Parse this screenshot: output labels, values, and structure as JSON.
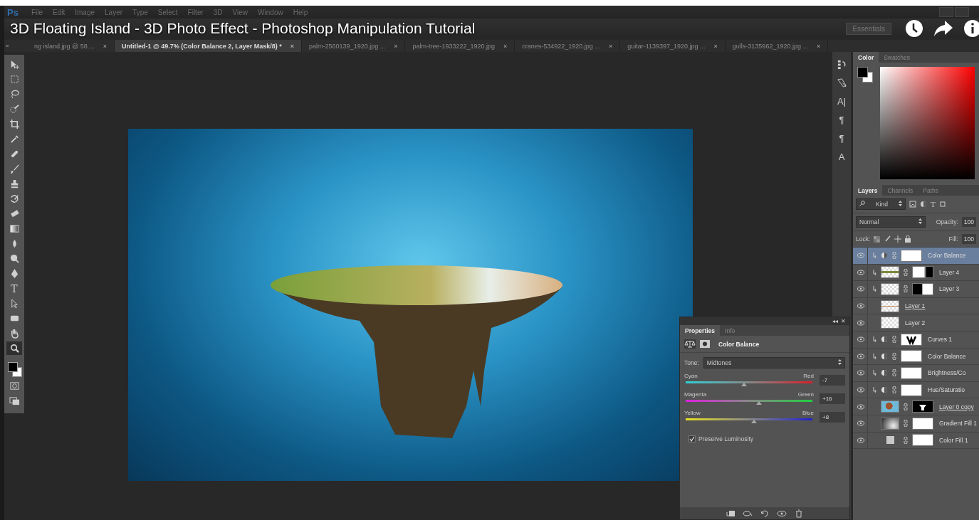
{
  "video_title": "3D Floating Island - 3D Photo Effect - Photoshop Manipulation Tutorial",
  "menu_bar": {
    "app_label": "Ps",
    "items": [
      "File",
      "Edit",
      "Image",
      "Layer",
      "Type",
      "Select",
      "Filter",
      "3D",
      "View",
      "Window",
      "Help"
    ]
  },
  "workspace": "Essentials",
  "tabs_collapse": "»",
  "document_tabs": [
    {
      "label": "ng island.jpg @ 58....",
      "close": "×",
      "selected": false
    },
    {
      "label": "Untitled-1 @ 49.7% (Color Balance 2, Layer Mask/8) *",
      "close": "×",
      "selected": true
    },
    {
      "label": "palm-2560139_1920.jpg ...",
      "close": "×",
      "selected": false
    },
    {
      "label": "palm-tree-1933222_1920.jpg",
      "close": "×",
      "selected": false
    },
    {
      "label": "cranes-534922_1920.jpg ...",
      "close": "×",
      "selected": false
    },
    {
      "label": "guitar-1139397_1920.jpg ...",
      "close": "×",
      "selected": false
    },
    {
      "label": "gulls-3135962_1920.jpg ...",
      "close": "×",
      "selected": false
    }
  ],
  "toolbar": {
    "tools": [
      {
        "kind": "move",
        "selected": false
      },
      {
        "kind": "marquee",
        "selected": false
      },
      {
        "kind": "lasso",
        "selected": false
      },
      {
        "kind": "quick-select",
        "selected": false
      },
      {
        "kind": "crop",
        "selected": false
      },
      {
        "kind": "eyedropper",
        "selected": false
      },
      {
        "kind": "healing",
        "selected": false
      },
      {
        "kind": "brush",
        "selected": false
      },
      {
        "kind": "stamp",
        "selected": false
      },
      {
        "kind": "history-brush",
        "selected": false
      },
      {
        "kind": "eraser",
        "selected": false
      },
      {
        "kind": "gradient",
        "selected": false
      },
      {
        "kind": "blur",
        "selected": false
      },
      {
        "kind": "dodge",
        "selected": false
      },
      {
        "kind": "pen",
        "selected": false
      },
      {
        "kind": "type",
        "glyph": "T",
        "selected": false
      },
      {
        "kind": "path-select",
        "selected": false
      },
      {
        "kind": "shape",
        "selected": false
      },
      {
        "kind": "hand",
        "selected": false
      },
      {
        "kind": "zoom",
        "selected": true
      }
    ]
  },
  "dock_icons": [
    {
      "kind": "history"
    },
    {
      "kind": "brushes"
    },
    {
      "kind": "character",
      "glyph": "A|"
    },
    {
      "kind": "paragraph",
      "glyph": "¶"
    },
    {
      "kind": "char-styles",
      "glyph": "¶"
    },
    {
      "kind": "para-styles",
      "glyph": "A"
    }
  ],
  "color_panel": {
    "tabs": [
      {
        "label": "Color",
        "selected": true
      },
      {
        "label": "Swatches",
        "selected": false
      }
    ]
  },
  "layers_panel": {
    "tabs": [
      {
        "label": "Layers",
        "selected": true
      },
      {
        "label": "Channels",
        "selected": false
      },
      {
        "label": "Paths",
        "selected": false
      }
    ],
    "filter": "Kind",
    "type_filter": "T",
    "blend_mode": "Normal",
    "opacity_label": "Opacity:",
    "opacity": "100",
    "lock_label": "Lock:",
    "fill_label": "Fill:",
    "fill": "100",
    "layers": [
      {
        "name": "Color Balance",
        "selected": true,
        "clipped": true,
        "adjustment": true,
        "mask": {
          "kind": "white"
        },
        "linked": false
      },
      {
        "name": "Layer 4",
        "selected": false,
        "clipped": true,
        "thumb": {
          "kind": "checker-green"
        },
        "mask": {
          "kind": "white-black"
        },
        "linked": false
      },
      {
        "name": "Layer 3",
        "selected": false,
        "clipped": true,
        "thumb": {
          "kind": "checker"
        },
        "mask": {
          "kind": "black-white"
        },
        "linked": false
      },
      {
        "name": "Layer 1",
        "selected": false,
        "clipped": false,
        "thumb": {
          "kind": "checker-orange"
        },
        "linked": true
      },
      {
        "name": "Layer 2",
        "selected": false,
        "clipped": false,
        "thumb": {
          "kind": "checker"
        },
        "linked": false
      },
      {
        "name": "Curves 1",
        "selected": false,
        "clipped": true,
        "adjustment": true,
        "mask": {
          "kind": "curves"
        },
        "linked": false
      },
      {
        "name": "Color Balance",
        "selected": false,
        "clipped": true,
        "adjustment": true,
        "mask": {
          "kind": "white"
        },
        "linked": false
      },
      {
        "name": "Brightness/Co",
        "selected": false,
        "clipped": true,
        "adjustment": true,
        "mask": {
          "kind": "white"
        },
        "linked": false
      },
      {
        "name": "Hue/Saturatio",
        "selected": false,
        "clipped": true,
        "adjustment": true,
        "mask": {
          "kind": "white"
        },
        "linked": false
      },
      {
        "name": "Layer 0 copy",
        "selected": false,
        "clipped": false,
        "thumb": {
          "kind": "photo"
        },
        "mask": {
          "kind": "black-shape"
        },
        "linked": true
      },
      {
        "name": "Gradient Fill 1",
        "selected": false,
        "clipped": false,
        "thumb": {
          "kind": "gradient"
        },
        "mask": {
          "kind": "white"
        },
        "linked": false
      },
      {
        "name": "Color Fill 1",
        "selected": false,
        "clipped": false,
        "thumb": {
          "kind": "swatch"
        },
        "mask": {
          "kind": "white"
        },
        "linked": false
      }
    ]
  },
  "properties_panel": {
    "collapse": "◂◂",
    "close": "✕",
    "tabs": [
      {
        "label": "Properties",
        "selected": true
      },
      {
        "label": "Info",
        "selected": false
      }
    ],
    "adjustment": "Color Balance",
    "tone_label": "Tone:",
    "tone": "Midtones",
    "sliders": [
      {
        "left": "Cyan",
        "right": "Red",
        "value": "-7",
        "level": 0.46,
        "kind": "cyan-red"
      },
      {
        "left": "Magenta",
        "right": "Green",
        "value": "+16",
        "level": 0.58,
        "kind": "magenta-green"
      },
      {
        "left": "Yellow",
        "right": "Blue",
        "value": "+8",
        "level": 0.54,
        "kind": "yellow-blue"
      }
    ],
    "preserve_luminosity": {
      "label": "Preserve Luminosity",
      "checked": true
    }
  }
}
